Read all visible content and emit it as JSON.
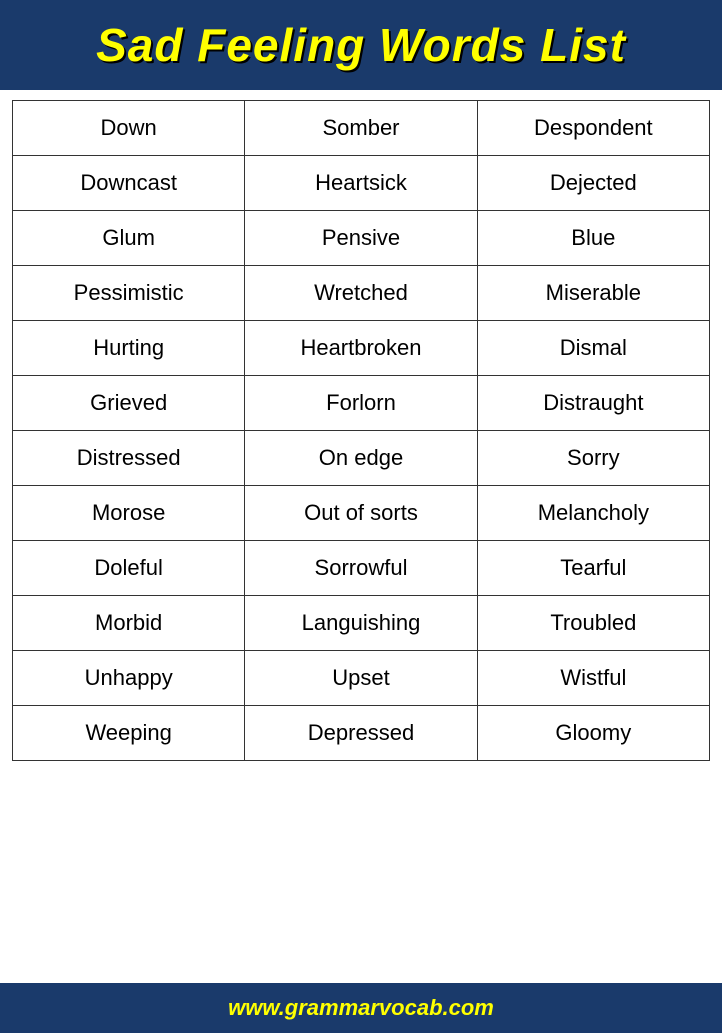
{
  "header": {
    "title": "Sad Feeling Words List"
  },
  "table": {
    "rows": [
      [
        "Down",
        "Somber",
        "Despondent"
      ],
      [
        "Downcast",
        "Heartsick",
        "Dejected"
      ],
      [
        "Glum",
        "Pensive",
        "Blue"
      ],
      [
        "Pessimistic",
        "Wretched",
        "Miserable"
      ],
      [
        "Hurting",
        "Heartbroken",
        "Dismal"
      ],
      [
        "Grieved",
        "Forlorn",
        "Distraught"
      ],
      [
        "Distressed",
        "On edge",
        "Sorry"
      ],
      [
        "Morose",
        "Out of sorts",
        "Melancholy"
      ],
      [
        "Doleful",
        "Sorrowful",
        "Tearful"
      ],
      [
        "Morbid",
        "Languishing",
        "Troubled"
      ],
      [
        "Unhappy",
        "Upset",
        "Wistful"
      ],
      [
        "Weeping",
        "Depressed",
        "Gloomy"
      ]
    ]
  },
  "footer": {
    "url": "www.grammarvocab.com"
  }
}
